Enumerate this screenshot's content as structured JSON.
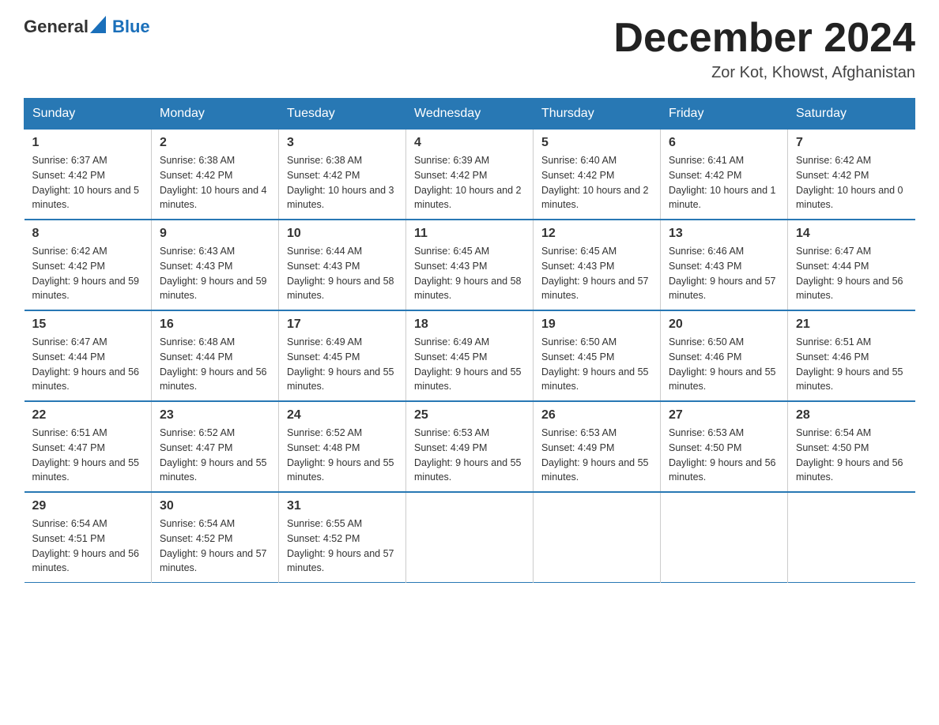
{
  "header": {
    "logo_general": "General",
    "logo_blue": "Blue",
    "month_year": "December 2024",
    "location": "Zor Kot, Khowst, Afghanistan"
  },
  "columns": [
    "Sunday",
    "Monday",
    "Tuesday",
    "Wednesday",
    "Thursday",
    "Friday",
    "Saturday"
  ],
  "weeks": [
    [
      {
        "day": "1",
        "sunrise": "6:37 AM",
        "sunset": "4:42 PM",
        "daylight": "10 hours and 5 minutes."
      },
      {
        "day": "2",
        "sunrise": "6:38 AM",
        "sunset": "4:42 PM",
        "daylight": "10 hours and 4 minutes."
      },
      {
        "day": "3",
        "sunrise": "6:38 AM",
        "sunset": "4:42 PM",
        "daylight": "10 hours and 3 minutes."
      },
      {
        "day": "4",
        "sunrise": "6:39 AM",
        "sunset": "4:42 PM",
        "daylight": "10 hours and 2 minutes."
      },
      {
        "day": "5",
        "sunrise": "6:40 AM",
        "sunset": "4:42 PM",
        "daylight": "10 hours and 2 minutes."
      },
      {
        "day": "6",
        "sunrise": "6:41 AM",
        "sunset": "4:42 PM",
        "daylight": "10 hours and 1 minute."
      },
      {
        "day": "7",
        "sunrise": "6:42 AM",
        "sunset": "4:42 PM",
        "daylight": "10 hours and 0 minutes."
      }
    ],
    [
      {
        "day": "8",
        "sunrise": "6:42 AM",
        "sunset": "4:42 PM",
        "daylight": "9 hours and 59 minutes."
      },
      {
        "day": "9",
        "sunrise": "6:43 AM",
        "sunset": "4:43 PM",
        "daylight": "9 hours and 59 minutes."
      },
      {
        "day": "10",
        "sunrise": "6:44 AM",
        "sunset": "4:43 PM",
        "daylight": "9 hours and 58 minutes."
      },
      {
        "day": "11",
        "sunrise": "6:45 AM",
        "sunset": "4:43 PM",
        "daylight": "9 hours and 58 minutes."
      },
      {
        "day": "12",
        "sunrise": "6:45 AM",
        "sunset": "4:43 PM",
        "daylight": "9 hours and 57 minutes."
      },
      {
        "day": "13",
        "sunrise": "6:46 AM",
        "sunset": "4:43 PM",
        "daylight": "9 hours and 57 minutes."
      },
      {
        "day": "14",
        "sunrise": "6:47 AM",
        "sunset": "4:44 PM",
        "daylight": "9 hours and 56 minutes."
      }
    ],
    [
      {
        "day": "15",
        "sunrise": "6:47 AM",
        "sunset": "4:44 PM",
        "daylight": "9 hours and 56 minutes."
      },
      {
        "day": "16",
        "sunrise": "6:48 AM",
        "sunset": "4:44 PM",
        "daylight": "9 hours and 56 minutes."
      },
      {
        "day": "17",
        "sunrise": "6:49 AM",
        "sunset": "4:45 PM",
        "daylight": "9 hours and 55 minutes."
      },
      {
        "day": "18",
        "sunrise": "6:49 AM",
        "sunset": "4:45 PM",
        "daylight": "9 hours and 55 minutes."
      },
      {
        "day": "19",
        "sunrise": "6:50 AM",
        "sunset": "4:45 PM",
        "daylight": "9 hours and 55 minutes."
      },
      {
        "day": "20",
        "sunrise": "6:50 AM",
        "sunset": "4:46 PM",
        "daylight": "9 hours and 55 minutes."
      },
      {
        "day": "21",
        "sunrise": "6:51 AM",
        "sunset": "4:46 PM",
        "daylight": "9 hours and 55 minutes."
      }
    ],
    [
      {
        "day": "22",
        "sunrise": "6:51 AM",
        "sunset": "4:47 PM",
        "daylight": "9 hours and 55 minutes."
      },
      {
        "day": "23",
        "sunrise": "6:52 AM",
        "sunset": "4:47 PM",
        "daylight": "9 hours and 55 minutes."
      },
      {
        "day": "24",
        "sunrise": "6:52 AM",
        "sunset": "4:48 PM",
        "daylight": "9 hours and 55 minutes."
      },
      {
        "day": "25",
        "sunrise": "6:53 AM",
        "sunset": "4:49 PM",
        "daylight": "9 hours and 55 minutes."
      },
      {
        "day": "26",
        "sunrise": "6:53 AM",
        "sunset": "4:49 PM",
        "daylight": "9 hours and 55 minutes."
      },
      {
        "day": "27",
        "sunrise": "6:53 AM",
        "sunset": "4:50 PM",
        "daylight": "9 hours and 56 minutes."
      },
      {
        "day": "28",
        "sunrise": "6:54 AM",
        "sunset": "4:50 PM",
        "daylight": "9 hours and 56 minutes."
      }
    ],
    [
      {
        "day": "29",
        "sunrise": "6:54 AM",
        "sunset": "4:51 PM",
        "daylight": "9 hours and 56 minutes."
      },
      {
        "day": "30",
        "sunrise": "6:54 AM",
        "sunset": "4:52 PM",
        "daylight": "9 hours and 57 minutes."
      },
      {
        "day": "31",
        "sunrise": "6:55 AM",
        "sunset": "4:52 PM",
        "daylight": "9 hours and 57 minutes."
      },
      null,
      null,
      null,
      null
    ]
  ]
}
